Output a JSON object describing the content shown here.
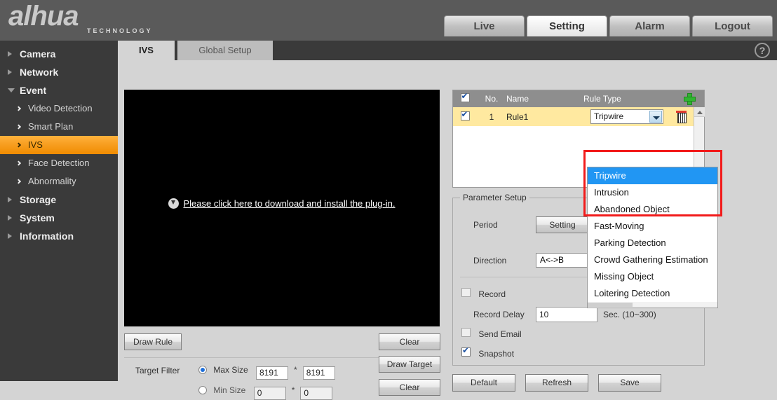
{
  "header": {
    "logo_text": "alhua",
    "logo_sub": "TECHNOLOGY",
    "nav": [
      {
        "label": "Live",
        "active": false
      },
      {
        "label": "Setting",
        "active": true
      },
      {
        "label": "Alarm",
        "active": false
      },
      {
        "label": "Logout",
        "active": false
      }
    ]
  },
  "sidebar": {
    "items": [
      {
        "label": "Camera"
      },
      {
        "label": "Network"
      },
      {
        "label": "Event"
      }
    ],
    "event_children": [
      {
        "label": "Video Detection"
      },
      {
        "label": "Smart Plan"
      },
      {
        "label": "IVS"
      },
      {
        "label": "Face Detection"
      },
      {
        "label": "Abnormality"
      }
    ],
    "items_tail": [
      {
        "label": "Storage"
      },
      {
        "label": "System"
      },
      {
        "label": "Information"
      }
    ]
  },
  "content": {
    "tabs": [
      {
        "label": "IVS",
        "active": true
      },
      {
        "label": "Global Setup",
        "active": false
      }
    ],
    "help_glyph": "?"
  },
  "video": {
    "plugin_message": "Please click here to download and install the plug-in."
  },
  "draw_controls": {
    "draw_rule": "Draw Rule",
    "clear_rule": "Clear",
    "target_filter_label": "Target Filter",
    "max_size_label": "Max Size",
    "max_width": "8191",
    "max_height": "8191",
    "min_size_label": "Min Size",
    "min_width": "0",
    "min_height": "0",
    "multiply": "*",
    "draw_target": "Draw Target",
    "clear_target": "Clear"
  },
  "rule_list": {
    "columns": {
      "no": "No.",
      "name": "Name",
      "rule_type": "Rule Type"
    },
    "rows": [
      {
        "no": "1",
        "name": "Rule1",
        "rule_type": "Tripwire",
        "checked": true
      }
    ]
  },
  "rule_type_dropdown": {
    "selected": "Tripwire",
    "options": [
      "Tripwire",
      "Intrusion",
      "Abandoned Object",
      "Fast-Moving",
      "Parking Detection",
      "Crowd Gathering Estimation",
      "Missing Object",
      "Loitering Detection"
    ]
  },
  "parameter_setup": {
    "legend": "Parameter Setup",
    "period_label": "Period",
    "period_button": "Setting",
    "direction_label": "Direction",
    "direction_value": "A<->B",
    "record_label": "Record",
    "record_checked": false,
    "record_delay_label": "Record Delay",
    "record_delay_value": "10",
    "record_delay_unit": "Sec. (10~300)",
    "send_email_label": "Send Email",
    "send_email_checked": false,
    "snapshot_label": "Snapshot",
    "snapshot_checked": true
  },
  "footer_buttons": {
    "default": "Default",
    "refresh": "Refresh",
    "save": "Save"
  },
  "colors": {
    "accent_orange": "#f79d1e",
    "highlight_red": "#f21b1b",
    "select_blue": "#2196f3",
    "row_yellow": "#ffe9a0"
  }
}
